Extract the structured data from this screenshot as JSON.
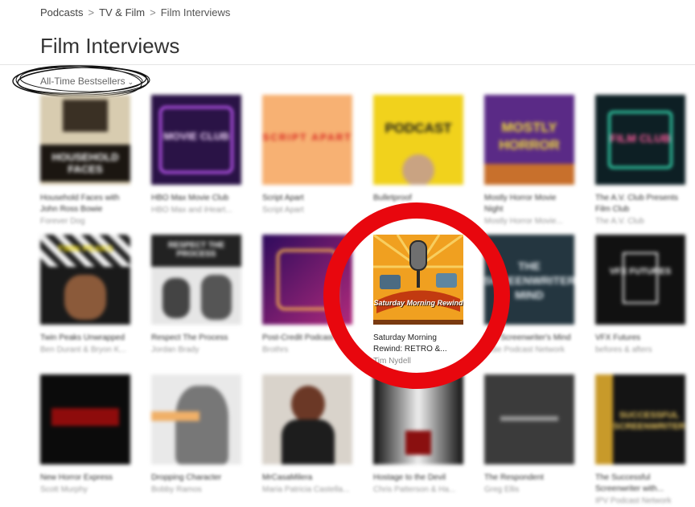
{
  "breadcrumb": {
    "items": [
      "Podcasts",
      "TV & Film",
      "Film Interviews"
    ],
    "separator": ">"
  },
  "page": {
    "title": "Film Interviews"
  },
  "sort": {
    "label": "All-Time Bestsellers",
    "icon": "chevron-down-icon"
  },
  "podcasts": [
    {
      "name": "Household Faces with John Ross Bowie",
      "author": "Forever Dog",
      "art_text": "HOUSEHOLD FACES"
    },
    {
      "name": "HBO Max Movie Club",
      "author": "HBO Max and iHeart...",
      "art_text": "MOVIE CLUB"
    },
    {
      "name": "Script Apart",
      "author": "Script Apart",
      "art_text": "SCRIPT APART"
    },
    {
      "name": "Bulletproof",
      "author": "",
      "art_text": "PODCAST"
    },
    {
      "name": "Mostly Horror Movie Night",
      "author": "Mostly Horror Movie...",
      "art_text": "MOSTLY HORROR"
    },
    {
      "name": "The A.V. Club Presents Film Club",
      "author": "The A.V. Club",
      "art_text": "FILM CLUB"
    },
    {
      "name": "Twin Peaks Unwrapped",
      "author": "Ben Durant & Bryon K...",
      "art_text": "TWIN PEAKS"
    },
    {
      "name": "Respect The Process",
      "author": "Jordan Brady",
      "art_text": "RESPECT THE PROCESS"
    },
    {
      "name": "Post-Credit Podcast",
      "author": "Brothrs",
      "art_text": ""
    },
    {
      "name": "Saturday Morning Rewind: RETRO &...",
      "author": "Tim Nydell",
      "art_text": "Saturday Morning Rewind"
    },
    {
      "name": "The Screenwriter's Mind",
      "author": "Indie Podcast Network",
      "art_text": "THE SCREENWRITER'S MIND"
    },
    {
      "name": "VFX Futures",
      "author": "befores & afters",
      "art_text": "VFX FUTURES"
    },
    {
      "name": "New Horror Express",
      "author": "Scott Murphy",
      "art_text": ""
    },
    {
      "name": "Dropping Character",
      "author": "Bobby Ramos",
      "art_text": ""
    },
    {
      "name": "MrCasaMilera",
      "author": "Maria Patricia Castella...",
      "art_text": ""
    },
    {
      "name": "Hostage to the Devil",
      "author": "Chris Patterson & Ha...",
      "art_text": ""
    },
    {
      "name": "The Respondent",
      "author": "Greg Ellis",
      "art_text": ""
    },
    {
      "name": "The Successful Screenwriter with...",
      "author": "IPV Podcast Network",
      "art_text": "SUCCESSFUL SCREENWRITER"
    }
  ],
  "colors": {
    "highlight_circle": "#e8070e",
    "text": "#333333",
    "muted": "#999999"
  }
}
